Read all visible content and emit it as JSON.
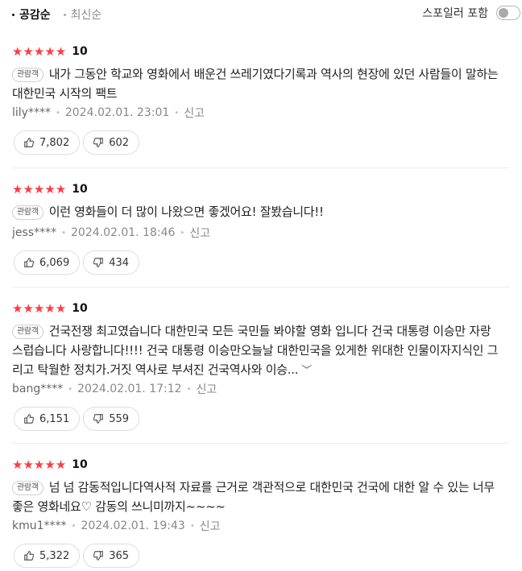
{
  "sort": {
    "top": "공감순",
    "latest": "최신순"
  },
  "spoiler": {
    "label": "스포일러 포함"
  },
  "reviews": [
    {
      "rating": "10",
      "tag": "관람객",
      "content": "내가 그동안 학교와 영화에서 배운건 쓰레기였다기록과 역사의 현장에 있던 사람들이 말하는 대한민국 시작의 팩트",
      "user": "lily****",
      "date": "2024.02.01. 23:01",
      "report": "신고",
      "likes": "7,802",
      "dislikes": "602"
    },
    {
      "rating": "10",
      "tag": "관람객",
      "content": "이런 영화들이 더 많이 나왔으면 좋겠어요! 잘봤습니다!!",
      "user": "jess****",
      "date": "2024.02.01. 18:46",
      "report": "신고",
      "likes": "6,069",
      "dislikes": "434"
    },
    {
      "rating": "10",
      "tag": "관람객",
      "content": "건국전쟁 최고였습니다 대한민국 모든 국민들 봐야할 영화 입니다 건국 대통령 이승만 자랑스럽습니다 사랑합니다!!!! 건국 대통령 이승만오늘날 대한민국을 있게한 위대한 인물이자지식인 그리고 탁월한 정치가.거짓 역사로 부셔진 건국역사와 이승...",
      "user": "bang****",
      "date": "2024.02.01. 17:12",
      "report": "신고",
      "likes": "6,151",
      "dislikes": "559"
    },
    {
      "rating": "10",
      "tag": "관람객",
      "content": "넘 넘 감동적입니다역사적 자료를 근거로 객관적으로 대한민국 건국에 대한 알 수 있는 너무 좋은 영화네요♡ 감동의 쓰니미까지~~~~",
      "user": "kmu1****",
      "date": "2024.02.01. 19:43",
      "report": "신고",
      "likes": "5,322",
      "dislikes": "365"
    }
  ],
  "icons": {
    "star": "star-icon",
    "like": "thumbs-up-icon",
    "dislike": "thumbs-down-icon",
    "more": "chevron-down-icon"
  },
  "colors": {
    "star": "#ff3b46",
    "border": "#dedede"
  }
}
